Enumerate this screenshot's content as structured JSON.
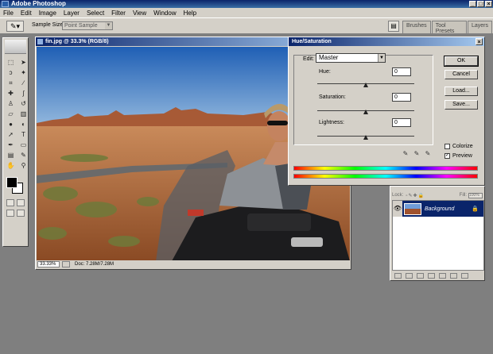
{
  "app": {
    "title": "Adobe Photoshop",
    "window_buttons": [
      "_",
      "□",
      "×"
    ]
  },
  "menu": [
    "File",
    "Edit",
    "Image",
    "Layer",
    "Select",
    "Filter",
    "View",
    "Window",
    "Help"
  ],
  "options_bar": {
    "tool_icon": "eyedropper-icon",
    "sample_size_label": "Sample Size:",
    "sample_size_value": "Point Sample",
    "palette_tabs": [
      "Brushes",
      "Tool Presets",
      "Layers"
    ]
  },
  "toolbox": {
    "tools": [
      "marquee-icon",
      "move-icon",
      "lasso-icon",
      "magic-wand-icon",
      "crop-icon",
      "slice-icon",
      "healing-icon",
      "brush-icon",
      "stamp-icon",
      "history-brush-icon",
      "eraser-icon",
      "gradient-icon",
      "blur-icon",
      "dodge-icon",
      "path-select-icon",
      "type-icon",
      "pen-icon",
      "shape-icon",
      "notes-icon",
      "eyedropper-icon",
      "hand-icon",
      "zoom-icon"
    ],
    "foreground_color": "#000000",
    "background_color": "#ffffff"
  },
  "document": {
    "title": "fin.jpg @ 33.3% (RGB/8)",
    "zoom": "33.33%",
    "doc_size": "Doc: 7.28M/7.28M"
  },
  "hue_saturation": {
    "title": "Hue/Saturation",
    "edit_label": "Edit:",
    "edit_value": "Master",
    "sliders": [
      {
        "label": "Hue:",
        "value": "0",
        "position": 0.5
      },
      {
        "label": "Saturation:",
        "value": "0",
        "position": 0.5
      },
      {
        "label": "Lightness:",
        "value": "0",
        "position": 0.5
      }
    ],
    "buttons": {
      "ok": "OK",
      "cancel": "Cancel",
      "load": "Load...",
      "save": "Save..."
    },
    "colorize_label": "Colorize",
    "colorize_checked": false,
    "preview_label": "Preview",
    "preview_checked": true
  },
  "layers_panel": {
    "lock_label": "Lock:",
    "fill_label": "Fill:",
    "fill_value": "100%",
    "layers": [
      {
        "name": "Background",
        "visible": true,
        "locked": true
      }
    ]
  }
}
